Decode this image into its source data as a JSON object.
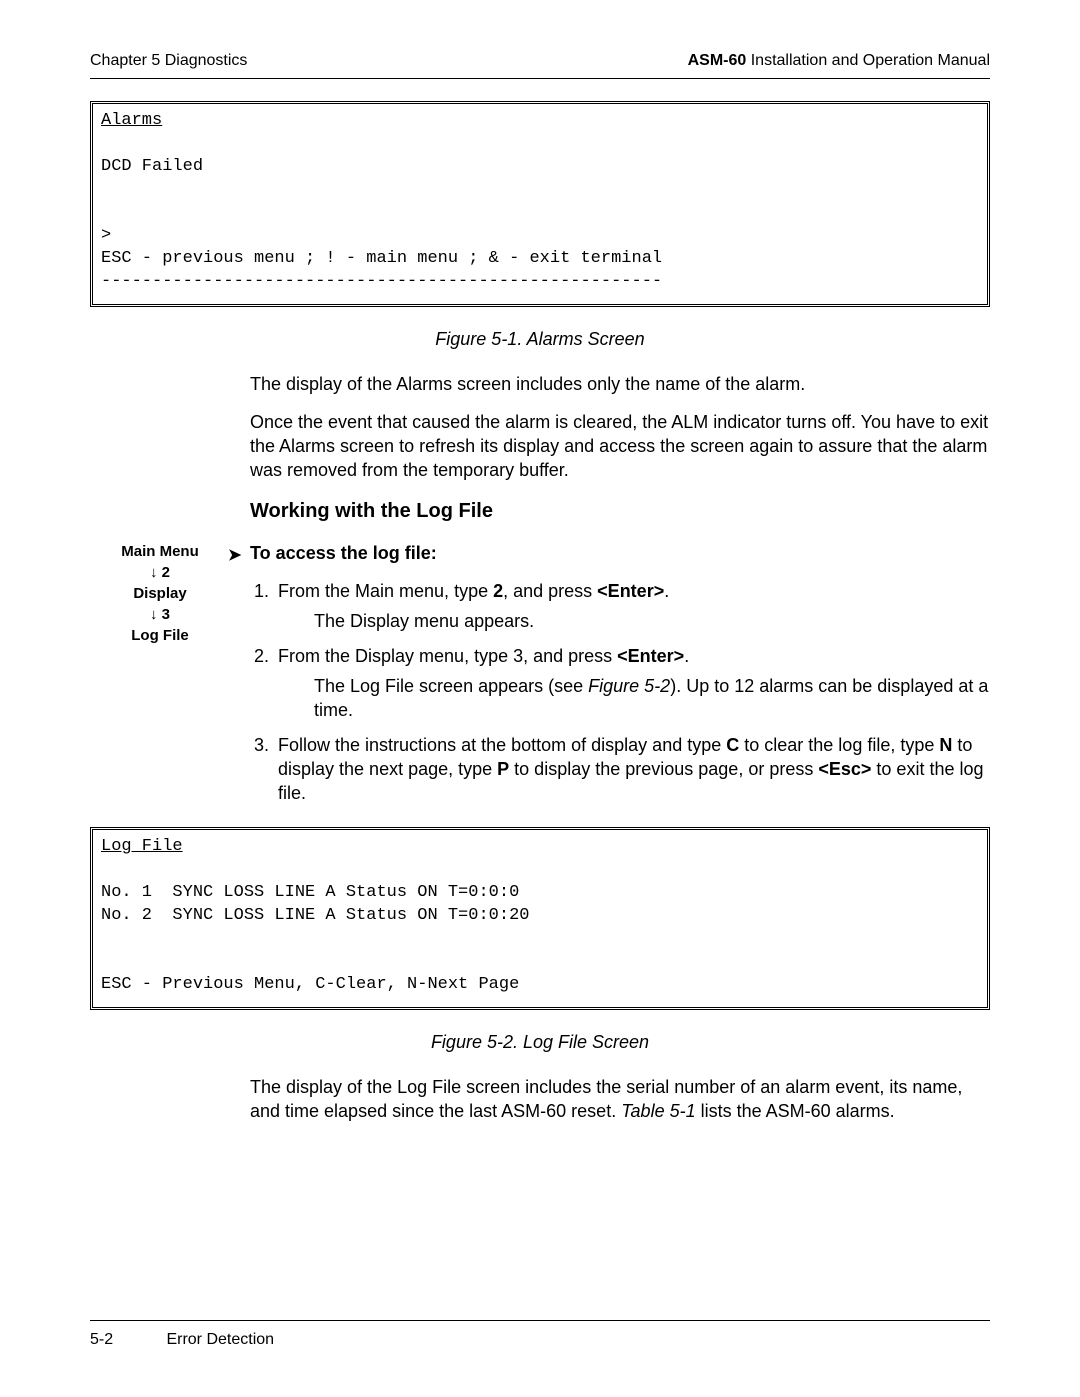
{
  "header": {
    "chapter": "Chapter 5  Diagnostics",
    "product_bold": "ASM-60",
    "product_rest": " Installation and Operation Manual"
  },
  "alarms_box": {
    "title": "Alarms",
    "line1": "DCD Failed",
    "prompt": ">",
    "nav": "ESC - previous menu ; ! - main menu ; & - exit terminal",
    "rule": "-------------------------------------------------------"
  },
  "fig1_caption": "Figure 5-1.  Alarms Screen",
  "para1": "The display of the Alarms screen includes only the name of the alarm.",
  "para2": "Once the event that caused the alarm is cleared, the ALM indicator turns off. You have to exit the Alarms screen to refresh its display and access the screen again to assure that the alarm was removed from the temporary buffer.",
  "h3": "Working with the Log File",
  "sidecar": {
    "l1": "Main Menu",
    "l2": "↓ 2",
    "l3": "Display",
    "l4": "↓ 3",
    "l5": "Log File"
  },
  "pointer": "➤",
  "lead": "To access the log file:",
  "steps": {
    "s1_a": "From the Main menu, type ",
    "s1_b": "2",
    "s1_c": ", and press ",
    "s1_d": "<Enter>",
    "s1_e": ".",
    "s1_indent": "The Display menu appears.",
    "s2_a": "From the Display menu, type 3, and press ",
    "s2_b": "<Enter>",
    "s2_c": ".",
    "s2_indent_a": "The Log File screen appears (see ",
    "s2_indent_i": "Figure 5-2",
    "s2_indent_b": "). Up to 12 alarms can be displayed at a time.",
    "s3_a": "Follow the instructions at the bottom of display and type ",
    "s3_b": "C",
    "s3_c": " to clear the log file, type ",
    "s3_d": "N",
    "s3_e": " to display the next page, type ",
    "s3_f": "P",
    "s3_g": " to display the previous page, or press ",
    "s3_h": "<Esc>",
    "s3_i": " to exit the log file."
  },
  "log_box": {
    "title": "Log File",
    "row1": "No. 1  SYNC LOSS LINE A Status ON T=0:0:0",
    "row2": "No. 2  SYNC LOSS LINE A Status ON T=0:0:20",
    "nav": "ESC - Previous Menu, C-Clear, N-Next Page"
  },
  "fig2_caption": "Figure 5-2.  Log File Screen",
  "para3_a": "The display of the Log File screen includes the serial number of an alarm event, its name, and time elapsed since the last ASM-60 reset. ",
  "para3_i": "Table 5-1",
  "para3_b": " lists the ASM-60 alarms.",
  "footer": {
    "page": "5-2",
    "section": "Error Detection"
  }
}
